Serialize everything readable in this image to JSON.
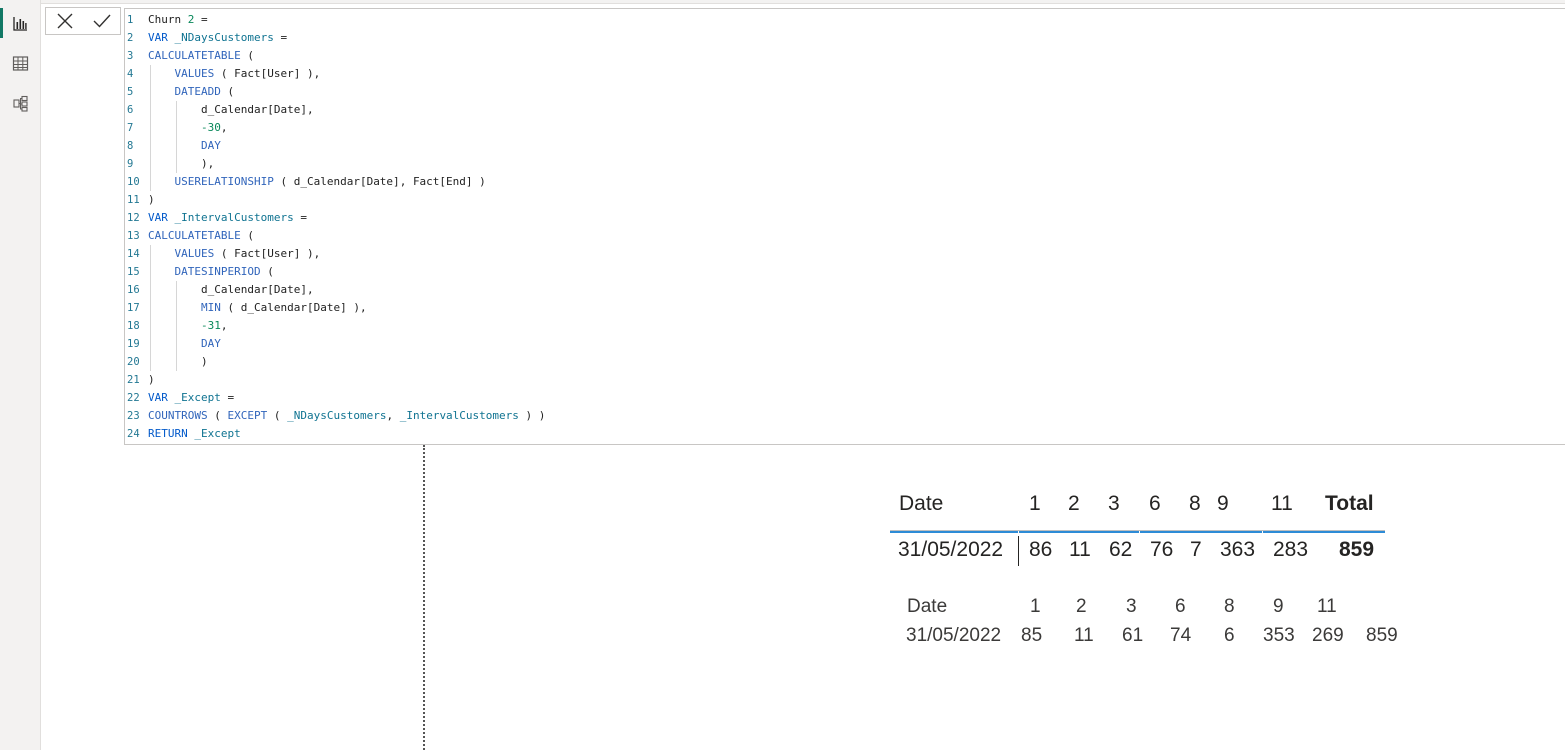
{
  "rail": {
    "items": [
      {
        "name": "report-view",
        "icon": "bar-chart-icon",
        "active": true
      },
      {
        "name": "table-view",
        "icon": "table-icon",
        "active": false
      },
      {
        "name": "model-view",
        "icon": "model-icon",
        "active": false
      }
    ]
  },
  "formula": {
    "cancel_icon": "close-icon",
    "commit_icon": "check-icon",
    "lines": [
      {
        "n": "1",
        "text": "Churn 2 ="
      },
      {
        "n": "2",
        "text": "VAR _NDaysCustomers ="
      },
      {
        "n": "3",
        "text": "CALCULATETABLE ("
      },
      {
        "n": "4",
        "text": "    VALUES ( Fact[User] ),"
      },
      {
        "n": "5",
        "text": "    DATEADD ("
      },
      {
        "n": "6",
        "text": "        d_Calendar[Date],"
      },
      {
        "n": "7",
        "text": "        -30,"
      },
      {
        "n": "8",
        "text": "        DAY"
      },
      {
        "n": "9",
        "text": "        ),"
      },
      {
        "n": "10",
        "text": "    USERELATIONSHIP ( d_Calendar[Date], Fact[End] )"
      },
      {
        "n": "11",
        "text": ")"
      },
      {
        "n": "12",
        "text": "VAR _IntervalCustomers ="
      },
      {
        "n": "13",
        "text": "CALCULATETABLE ("
      },
      {
        "n": "14",
        "text": "    VALUES ( Fact[User] ),"
      },
      {
        "n": "15",
        "text": "    DATESINPERIOD ("
      },
      {
        "n": "16",
        "text": "        d_Calendar[Date],"
      },
      {
        "n": "17",
        "text": "        MIN ( d_Calendar[Date] ),"
      },
      {
        "n": "18",
        "text": "        -31,"
      },
      {
        "n": "19",
        "text": "        DAY"
      },
      {
        "n": "20",
        "text": "        )"
      },
      {
        "n": "21",
        "text": ")"
      },
      {
        "n": "22",
        "text": "VAR _Except ="
      },
      {
        "n": "23",
        "text": "COUNTROWS ( EXCEPT ( _NDaysCustomers, _IntervalCustomers ) )"
      },
      {
        "n": "24",
        "text": "RETURN _Except"
      }
    ]
  },
  "matrix": {
    "header": {
      "date": "Date",
      "cols": [
        "1",
        "2",
        "3",
        "6",
        "8",
        "9",
        "11"
      ],
      "total": "Total"
    },
    "row": {
      "date": "31/05/2022",
      "values": [
        "86",
        "11",
        "62",
        "76",
        "7",
        "363",
        "283"
      ],
      "total": "859"
    }
  },
  "table2": {
    "header": {
      "date": "Date",
      "cols": [
        "1",
        "2",
        "3",
        "6",
        "8",
        "9",
        "11"
      ]
    },
    "row": {
      "date": "31/05/2022",
      "values": [
        "85",
        "11",
        "61",
        "74",
        "6",
        "353",
        "269",
        "859"
      ]
    }
  }
}
